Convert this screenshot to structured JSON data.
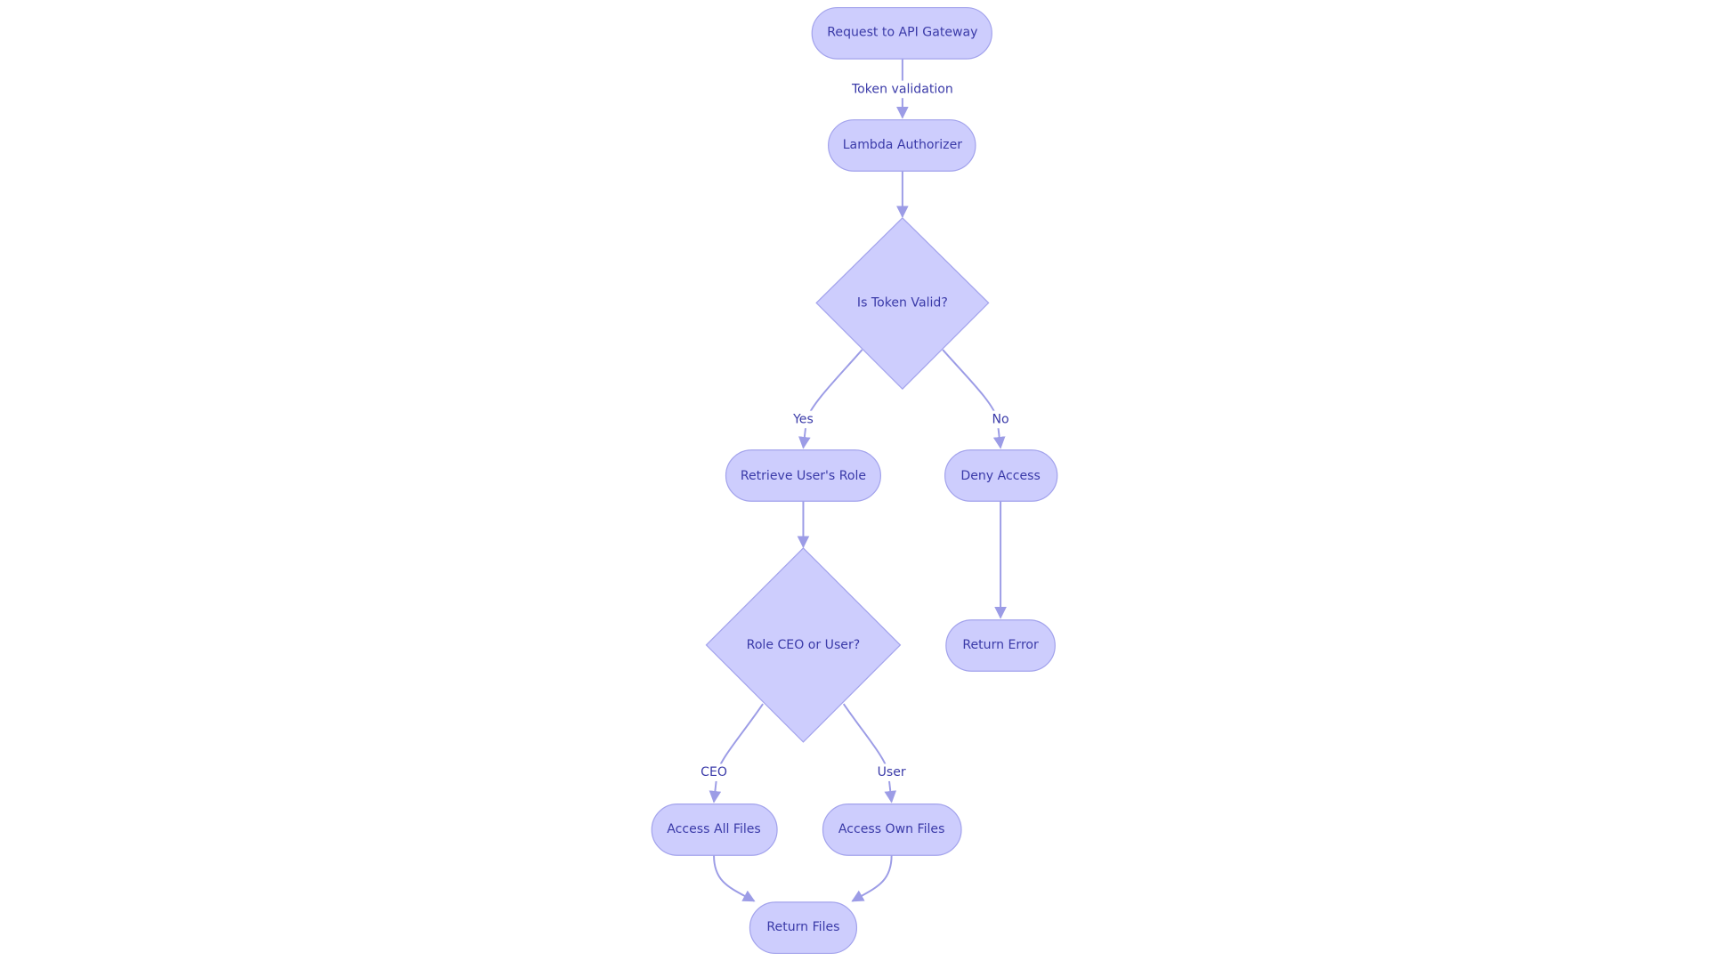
{
  "diagram": {
    "colors": {
      "node_fill": "#cdcdfd",
      "node_stroke": "#a3a3ec",
      "edge": "#9c9ce6",
      "text": "#3a3aa8"
    },
    "nodes": {
      "request": "Request to API Gateway",
      "lambda": "Lambda Authorizer",
      "token_valid": "Is Token Valid?",
      "retrieve_role": "Retrieve User's Role",
      "deny": "Deny Access",
      "role_check": "Role CEO or User?",
      "return_error": "Return Error",
      "access_all": "Access All Files",
      "access_own": "Access Own Files",
      "return_files": "Return Files"
    },
    "edges": {
      "token_validation": "Token validation",
      "yes": "Yes",
      "no": "No",
      "ceo": "CEO",
      "user": "User"
    }
  }
}
